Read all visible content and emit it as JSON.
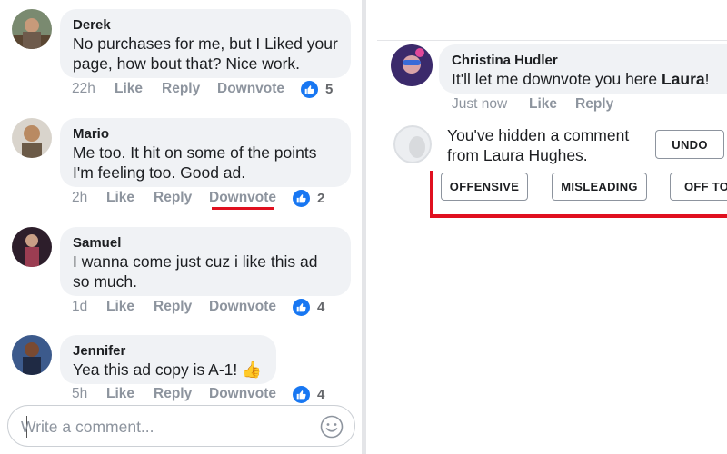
{
  "left_panel": {
    "comments": [
      {
        "author": "Derek",
        "text_lines": [
          "No purchases for me, but I Liked your",
          "page, how bout that? Nice work."
        ],
        "time": "22h",
        "like_label": "Like",
        "reply_label": "Reply",
        "downvote_label": "Downvote",
        "like_count": "5"
      },
      {
        "author": "Mario",
        "text_lines": [
          "Me too. It hit on some of the points",
          "I'm feeling too. Good ad."
        ],
        "time": "2h",
        "like_label": "Like",
        "reply_label": "Reply",
        "downvote_label": "Downvote",
        "like_count": "2"
      },
      {
        "author": "Samuel",
        "text_lines": [
          "I wanna come just cuz i like this ad",
          "so much."
        ],
        "time": "1d",
        "like_label": "Like",
        "reply_label": "Reply",
        "downvote_label": "Downvote",
        "like_count": "4"
      },
      {
        "author": "Jennifer",
        "text_lines": [
          "Yea this ad copy is A-1! 👍"
        ],
        "time": "5h",
        "like_label": "Like",
        "reply_label": "Reply",
        "downvote_label": "Downvote",
        "like_count": "4"
      }
    ],
    "composer": {
      "placeholder": "Write a comment...",
      "value": "",
      "emoji_icon": "smiley-icon"
    }
  },
  "right_panel": {
    "comment": {
      "author": "Christina Hudler",
      "text_prefix": "It'll let me downvote you here ",
      "text_bold": "Laura",
      "text_suffix": "!",
      "time": "Just now",
      "like_label": "Like",
      "reply_label": "Reply"
    },
    "hidden_notice": {
      "line1": "You've hidden a comment",
      "line2": "from Laura Hughes.",
      "undo_label": "UNDO",
      "reasons": [
        "OFFENSIVE",
        "MISLEADING",
        "OFF TO"
      ]
    }
  },
  "colors": {
    "accent_blue": "#1877f2",
    "highlight_red": "#e0101f",
    "bubble_gray": "#f0f2f5",
    "meta_gray": "#8d949e"
  }
}
